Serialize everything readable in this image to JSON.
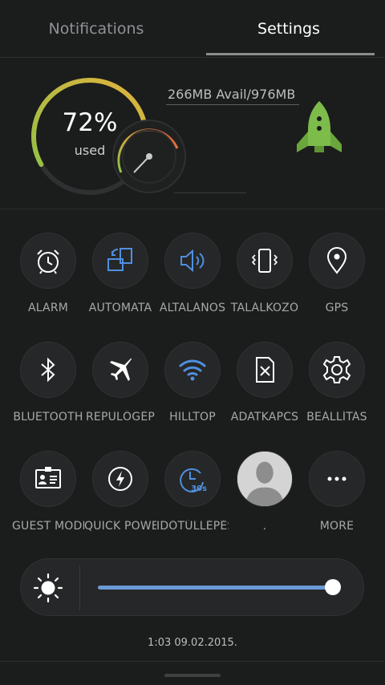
{
  "tabs": {
    "notifications": "Notifications",
    "settings": "Settings",
    "active": "settings"
  },
  "memory": {
    "percent_text": "72%",
    "used_label": "used",
    "avail_text": "266MB Avail/976MB",
    "usage_fraction": 0.72
  },
  "tiles": [
    {
      "label": "ALARM",
      "icon": "alarm-clock-icon"
    },
    {
      "label": "AUTOMATA",
      "icon": "auto-rotate-icon"
    },
    {
      "label": "ÁLTALÁNOS",
      "icon": "speaker-volume-icon"
    },
    {
      "label": "TALÁLKOZÓ",
      "icon": "vibrate-phone-icon"
    },
    {
      "label": "GPS",
      "icon": "location-pin-icon"
    },
    {
      "label": "BLUETOOTH",
      "icon": "bluetooth-icon"
    },
    {
      "label": "REPÜLŐGÉP",
      "icon": "airplane-icon"
    },
    {
      "label": "HILLTOP",
      "icon": "wifi-icon"
    },
    {
      "label": "ADATKAPCS",
      "icon": "sim-card-off-icon"
    },
    {
      "label": "BEÁLLÍTÁS",
      "icon": "gear-icon"
    },
    {
      "label": "GUEST MODE",
      "icon": "id-card-icon"
    },
    {
      "label": "QUICK POWER",
      "icon": "power-bolt-icon"
    },
    {
      "label": "IDŐTÚLLÉPÉS",
      "icon": "timeout-clock-icon",
      "badge": "30s"
    },
    {
      "label": ".",
      "icon": "user-avatar-icon"
    },
    {
      "label": "MORE",
      "icon": "more-dots-icon"
    }
  ],
  "brightness": {
    "level": 0.99
  },
  "status": {
    "datetime": "1:03  09.02.2015."
  },
  "colors": {
    "accent_blue": "#4f8fe0",
    "gauge_green": "#8fc148",
    "gauge_yellow": "#e3b23c",
    "rocket_green": "#7dbb4a",
    "background": "#1b1c1c"
  }
}
